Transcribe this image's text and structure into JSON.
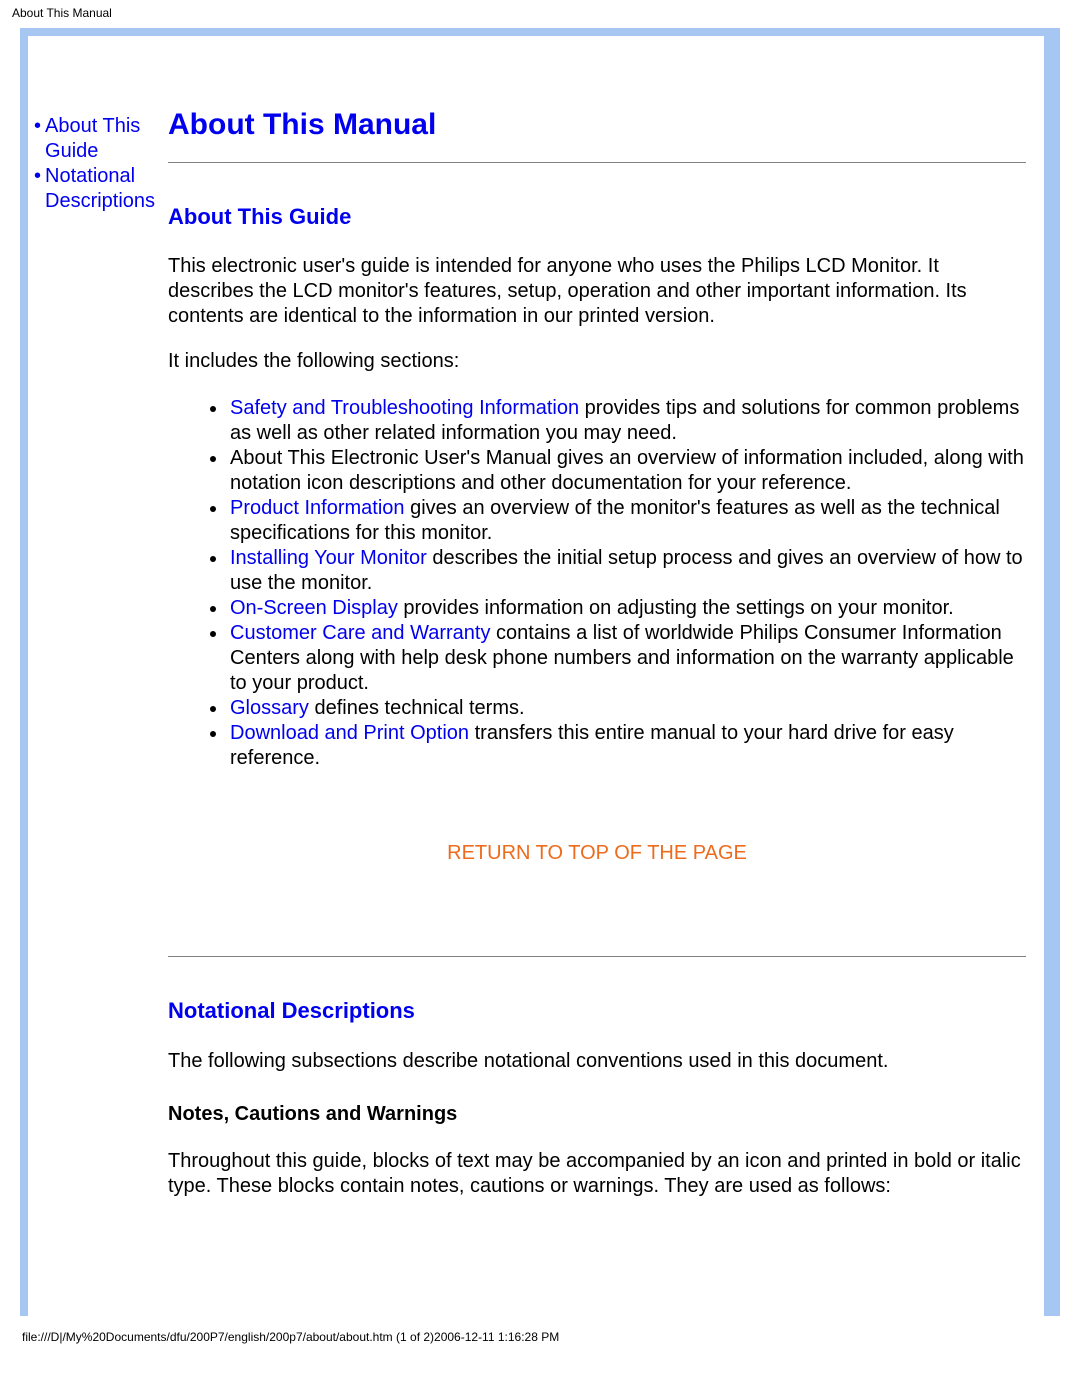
{
  "header": {
    "title": "About This Manual"
  },
  "sidebar": {
    "items": [
      {
        "label_line1": "About This",
        "label_line2": "Guide"
      },
      {
        "label_line1": "Notational",
        "label_line2": "Descriptions"
      }
    ]
  },
  "main": {
    "title": "About This Manual",
    "section1": {
      "heading": "About This Guide",
      "intro": "This electronic user's guide is intended for anyone who uses the Philips LCD Monitor. It describes the LCD monitor's features, setup, operation and other important information. Its contents are identical to the information in our printed version.",
      "lead": "It includes the following sections:",
      "bullets": [
        {
          "link": "Safety and Troubleshooting Information",
          "text_after": " provides tips and solutions for common problems as well as other related information you may need."
        },
        {
          "link": "",
          "text_after": "About This Electronic User's Manual gives an overview of information included, along with notation icon descriptions and other documentation for your reference."
        },
        {
          "link": "Product Information",
          "text_after": " gives an overview of the monitor's features as well as the technical specifications for this monitor."
        },
        {
          "link": "Installing Your Monitor",
          "text_after": " describes the initial setup process and gives an overview of how to use the monitor."
        },
        {
          "link": "On-Screen Display",
          "text_after": " provides information on adjusting the settings on your monitor."
        },
        {
          "link": "Customer Care and Warranty",
          "text_after": " contains a list of worldwide Philips Consumer Information Centers along with help desk phone numbers and information on the warranty applicable to your product."
        },
        {
          "link": "Glossary",
          "text_after": " defines technical terms."
        },
        {
          "link": "Download and Print Option",
          "text_after": " transfers this entire manual to your hard drive for easy reference."
        }
      ]
    },
    "return_top": "RETURN TO TOP OF THE PAGE",
    "section2": {
      "heading": "Notational Descriptions",
      "intro": "The following subsections describe notational conventions used in this document.",
      "subheading": "Notes, Cautions and Warnings",
      "body": "Throughout this guide, blocks of text may be accompanied by an icon and printed in bold or italic type. These blocks contain notes, cautions or warnings. They are used as follows:"
    }
  },
  "footer": {
    "path": "file:///D|/My%20Documents/dfu/200P7/english/200p7/about/about.htm (1 of 2)2006-12-11 1:16:28 PM"
  }
}
